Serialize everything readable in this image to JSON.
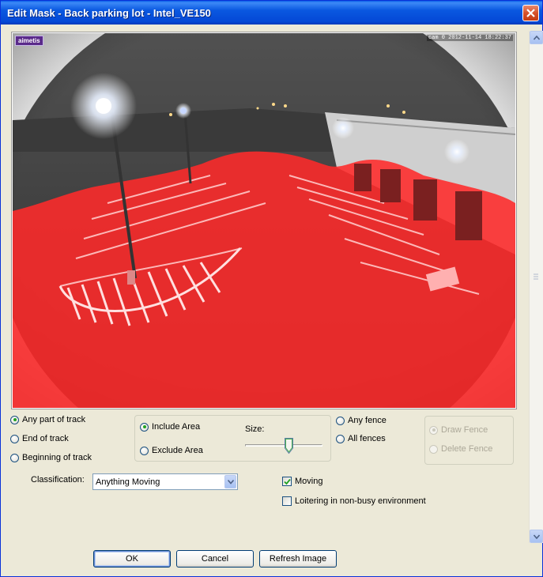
{
  "window": {
    "title": "Edit Mask - Back parking lot - Intel_VE150"
  },
  "video": {
    "logo_text": "aimetis",
    "timestamp": "cam 0 2012-11-14 18:22:37",
    "mask_color": "#ff2a2a"
  },
  "track_options": {
    "items": [
      {
        "label": "Any part of track",
        "selected": true
      },
      {
        "label": "End of track",
        "selected": false
      },
      {
        "label": "Beginning of track",
        "selected": false
      }
    ]
  },
  "area_options": {
    "include_label": "Include Area",
    "exclude_label": "Exclude Area",
    "include_selected": true,
    "size_label": "Size:",
    "size_value_fraction": 0.58
  },
  "fence_options": {
    "any_label": "Any fence",
    "all_label": "All fences",
    "draw_label": "Draw Fence",
    "delete_label": "Delete Fence"
  },
  "classification": {
    "label": "Classification:",
    "value": "Anything Moving"
  },
  "checks": {
    "moving_label": "Moving",
    "moving_checked": true,
    "loitering_label": "Loitering in non-busy environment",
    "loitering_checked": false
  },
  "buttons": {
    "ok": "OK",
    "cancel": "Cancel",
    "refresh": "Refresh Image"
  }
}
